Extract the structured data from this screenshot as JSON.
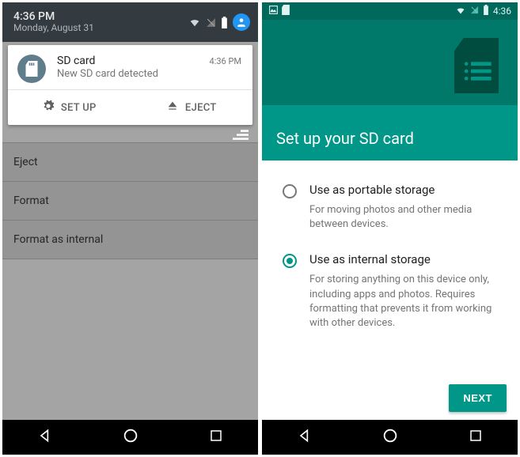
{
  "left": {
    "status": {
      "time": "4:36 PM",
      "date": "Monday, August 31"
    },
    "notification": {
      "title": "SD card",
      "subtitle": "New SD card detected",
      "timestamp": "4:36 PM",
      "actions": {
        "setup": "SET UP",
        "eject": "EJECT"
      }
    },
    "menu": {
      "eject": "Eject",
      "format": "Format",
      "format_internal": "Format as internal"
    }
  },
  "right": {
    "status": {
      "time": "4:36"
    },
    "header": {
      "title": "Set up your SD card"
    },
    "options": {
      "portable": {
        "label": "Use as portable storage",
        "desc": "For moving photos and other media between devices."
      },
      "internal": {
        "label": "Use as internal storage",
        "desc": "For storing anything on this device only, including apps and photos. Requires formatting that prevents it from working with other devices."
      }
    },
    "next": "NEXT"
  }
}
